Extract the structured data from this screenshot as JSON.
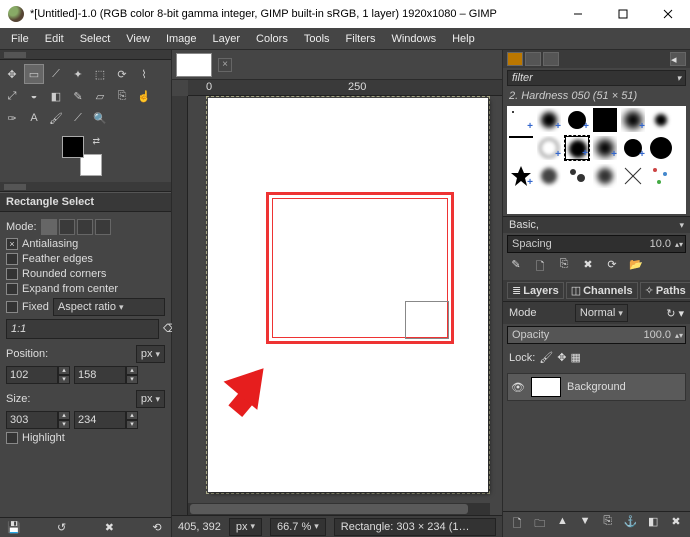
{
  "title": "*[Untitled]-1.0 (RGB color 8-bit gamma integer, GIMP built-in sRGB, 1 layer) 1920x1080 – GIMP",
  "menu": [
    "File",
    "Edit",
    "Select",
    "View",
    "Image",
    "Layer",
    "Colors",
    "Tools",
    "Filters",
    "Windows",
    "Help"
  ],
  "toolopts": {
    "title": "Rectangle Select",
    "mode_label": "Mode:",
    "antialias": "Antialiasing",
    "feather": "Feather edges",
    "rounded": "Rounded corners",
    "expand": "Expand from center",
    "fixed": "Fixed",
    "fixed_type": "Aspect ratio",
    "ratio": "1:1",
    "position": "Position:",
    "pos_unit": "px",
    "pos_x": "102",
    "pos_y": "158",
    "size": "Size:",
    "size_unit": "px",
    "size_w": "303",
    "size_h": "234",
    "highlight": "Highlight"
  },
  "ruler": {
    "t0": "0",
    "t1": "250"
  },
  "status": {
    "coord": "405, 392",
    "unit": "px",
    "zoom": "66.7 %",
    "msg": "Rectangle: 303 × 234 (1…"
  },
  "brushes": {
    "filter_ph": "filter",
    "current": "2. Hardness 050 (51 × 51)",
    "preset": "Basic,",
    "spacing_label": "Spacing",
    "spacing_val": "10.0"
  },
  "layers": {
    "tab_layers": "Layers",
    "tab_channels": "Channels",
    "tab_paths": "Paths",
    "mode_label": "Mode",
    "mode_val": "Normal",
    "opacity_label": "Opacity",
    "opacity_val": "100.0",
    "lock_label": "Lock:",
    "layer0": "Background"
  },
  "chart_data": null
}
